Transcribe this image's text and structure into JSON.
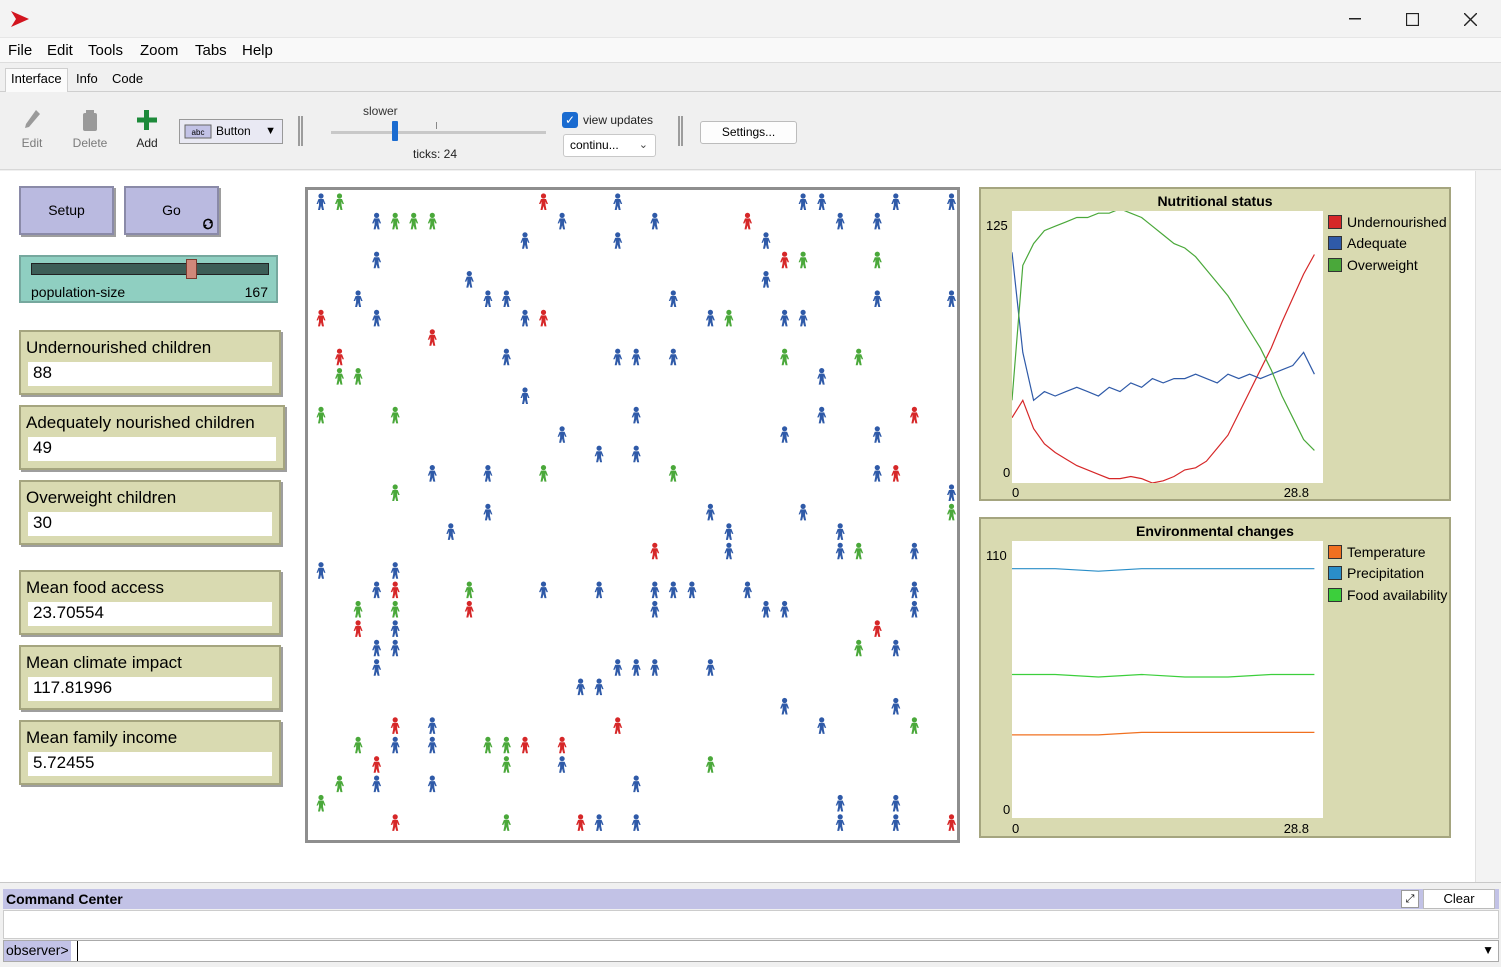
{
  "menu": [
    "File",
    "Edit",
    "Tools",
    "Zoom",
    "Tabs",
    "Help"
  ],
  "tabs": [
    "Interface",
    "Info",
    "Code"
  ],
  "toolbar": {
    "edit": "Edit",
    "delete": "Delete",
    "add": "Add",
    "widget_type": "Button",
    "speed_label": "slower",
    "ticks_label": "ticks: 24",
    "view_updates_label": "view updates",
    "view_updates_checked": true,
    "update_mode": "continu...",
    "settings": "Settings..."
  },
  "buttons": {
    "setup": "Setup",
    "go": "Go"
  },
  "slider": {
    "name": "population-size",
    "value": "167",
    "fraction": 0.69
  },
  "monitors": [
    {
      "label": "Undernourished children",
      "value": "88"
    },
    {
      "label": "Adequately nourished children",
      "value": "49"
    },
    {
      "label": "Overweight children",
      "value": "30"
    },
    {
      "label": "Mean food access",
      "value": "23.70554"
    },
    {
      "label": "Mean climate impact",
      "value": "117.81996"
    },
    {
      "label": "Mean family income",
      "value": "5.72455"
    }
  ],
  "colors": {
    "red": "#d62728",
    "blue": "#2f5aa8",
    "green": "#4aa83a",
    "orange": "#f07020",
    "cyan": "#2a8ec8",
    "lime": "#3ccf3c"
  },
  "chart_data": [
    {
      "type": "line",
      "title": "Nutritional status",
      "xlim": [
        0,
        28.8
      ],
      "ylim": [
        0,
        125
      ],
      "x_tick_labels": [
        "0",
        "28.8"
      ],
      "y_tick_labels": [
        "0",
        "125"
      ],
      "x": [
        0,
        1,
        2,
        3,
        4,
        5,
        6,
        7,
        8,
        9,
        10,
        11,
        12,
        13,
        14,
        15,
        16,
        17,
        18,
        19,
        20,
        21,
        22,
        23,
        24,
        25,
        26,
        27,
        28
      ],
      "series": [
        {
          "name": "Undernourished",
          "color": "#d62728",
          "values": [
            30,
            38,
            25,
            18,
            14,
            11,
            8,
            6,
            4,
            2,
            2,
            3,
            2,
            0,
            1,
            3,
            6,
            7,
            10,
            16,
            22,
            32,
            42,
            52,
            62,
            74,
            85,
            96,
            105
          ]
        },
        {
          "name": "Adequate",
          "color": "#2f5aa8",
          "values": [
            106,
            60,
            38,
            42,
            40,
            42,
            44,
            42,
            40,
            44,
            42,
            46,
            44,
            48,
            46,
            48,
            48,
            50,
            48,
            46,
            50,
            48,
            50,
            48,
            50,
            52,
            54,
            60,
            50
          ]
        },
        {
          "name": "Overweight",
          "color": "#4aa83a",
          "values": [
            38,
            100,
            110,
            116,
            118,
            120,
            122,
            122,
            124,
            124,
            126,
            124,
            122,
            118,
            114,
            110,
            108,
            104,
            98,
            92,
            86,
            78,
            70,
            62,
            52,
            40,
            30,
            20,
            15
          ]
        }
      ]
    },
    {
      "type": "line",
      "title": "Environmental changes",
      "xlim": [
        0,
        28.8
      ],
      "ylim": [
        0,
        110
      ],
      "x_tick_labels": [
        "0",
        "28.8"
      ],
      "y_tick_labels": [
        "0",
        "110"
      ],
      "x": [
        0,
        4,
        8,
        12,
        16,
        20,
        24,
        28
      ],
      "series": [
        {
          "name": "Temperature",
          "color": "#f07020",
          "values": [
            33,
            33,
            33,
            34,
            34,
            34,
            34,
            34
          ]
        },
        {
          "name": "Precipitation",
          "color": "#2a8ec8",
          "values": [
            99,
            99,
            98,
            99,
            99,
            99,
            99,
            99
          ]
        },
        {
          "name": "Food availability",
          "color": "#3ccf3c",
          "values": [
            57,
            57,
            56,
            57,
            56,
            56,
            57,
            57
          ]
        }
      ]
    }
  ],
  "command_center": {
    "title": "Command Center",
    "clear": "Clear",
    "prompt": "observer>",
    "input": ""
  }
}
